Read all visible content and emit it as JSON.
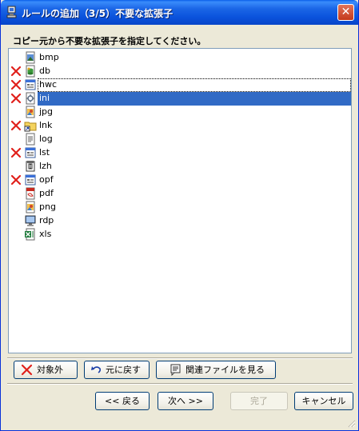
{
  "window": {
    "title": "ルールの追加（3/5）不要な拡張子",
    "close_symbol": "✕"
  },
  "instruction": "コピー元から不要な拡張子を指定してください。",
  "extensions": [
    {
      "label": "bmp",
      "icon": "bitmap-file-icon",
      "excluded": false
    },
    {
      "label": "db",
      "icon": "database-file-icon",
      "excluded": true
    },
    {
      "label": "hwc",
      "icon": "application-file-icon",
      "excluded": true
    },
    {
      "label": "ini",
      "icon": "settings-file-icon",
      "excluded": true,
      "selected": true
    },
    {
      "label": "jpg",
      "icon": "image-file-icon",
      "excluded": false
    },
    {
      "label": "lnk",
      "icon": "shortcut-folder-icon",
      "excluded": true
    },
    {
      "label": "log",
      "icon": "text-file-icon",
      "excluded": false
    },
    {
      "label": "lst",
      "icon": "application-file-icon",
      "excluded": true
    },
    {
      "label": "lzh",
      "icon": "archive-file-icon",
      "excluded": false
    },
    {
      "label": "opf",
      "icon": "application-file-icon",
      "excluded": true
    },
    {
      "label": "pdf",
      "icon": "pdf-file-icon",
      "excluded": false
    },
    {
      "label": "png",
      "icon": "image-file-icon",
      "excluded": false
    },
    {
      "label": "rdp",
      "icon": "remote-desktop-file-icon",
      "excluded": false
    },
    {
      "label": "xls",
      "icon": "excel-file-icon",
      "excluded": false
    }
  ],
  "actions": {
    "exclude_label": "対象外",
    "restore_label": "元に戻す",
    "related_label": "関連ファイルを見る"
  },
  "nav": {
    "back_label": "<< 戻る",
    "next_label": "次へ >>",
    "finish_label": "完了",
    "cancel_label": "キャンセル"
  },
  "colors": {
    "selection": "#316AC5",
    "exclude_mark": "#E0201B",
    "title_bar": "#0A52DC",
    "dialog_face": "#ECE9D8"
  }
}
